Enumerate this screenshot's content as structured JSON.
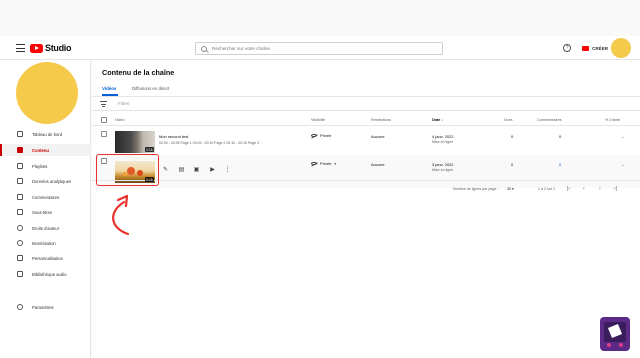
{
  "topbar": {
    "logo_text": "Studio",
    "search_placeholder": "Rechercher sur votre chaîne",
    "create_label": "CRÉER"
  },
  "sidebar": {
    "items": [
      {
        "label": "Tableau de bord",
        "icon": "dashboard-icon"
      },
      {
        "label": "Contenu",
        "icon": "content-icon",
        "active": true
      },
      {
        "label": "Playlists",
        "icon": "playlist-icon"
      },
      {
        "label": "Données analytiques",
        "icon": "analytics-icon"
      },
      {
        "label": "Commentaires",
        "icon": "comments-icon"
      },
      {
        "label": "Sous-titres",
        "icon": "subtitles-icon"
      },
      {
        "label": "Droits d'auteur",
        "icon": "copyright-icon"
      },
      {
        "label": "Monétisation",
        "icon": "monetization-icon"
      },
      {
        "label": "Personnalisation",
        "icon": "customization-icon"
      },
      {
        "label": "Bibliothèque audio",
        "icon": "audio-library-icon"
      }
    ],
    "settings_label": "Paramètres"
  },
  "main": {
    "title": "Contenu de la chaîne",
    "tabs": [
      {
        "label": "Vidéos",
        "active": true
      },
      {
        "label": "Diffusions en direct"
      }
    ],
    "filter_label": "Filtrer",
    "columns": [
      "Vidéo",
      "Visibilité",
      "Restrictions",
      "Date",
      "Vues",
      "Commentaires",
      "% J'aime"
    ],
    "rows": [
      {
        "title": "Mon second test",
        "description": "00:00 - 00:05 Page 1 00:05 - 00:10 Page 2 00:10 - 00:15 Page 3",
        "duration": "0:15",
        "visibility": "Privée",
        "restrictions": "Aucune",
        "date": "4 janv. 2022",
        "date_sub": "Mise en ligne",
        "views": "0",
        "comments": "0",
        "likes": "–"
      },
      {
        "title": "",
        "description": "",
        "duration": "0:15",
        "visibility": "Privée",
        "restrictions": "Aucune",
        "date": "3 janv. 2022",
        "date_sub": "Mise en ligne",
        "views": "0",
        "comments": "0",
        "likes": "–"
      }
    ],
    "pagination": {
      "rows_per_page_label": "Nombre de lignes par page :",
      "rows_per_page": "30",
      "range": "1 à 2 sur 2"
    }
  },
  "colors": {
    "accent": "#cc0000",
    "link": "#065fd4",
    "avatar": "#f5c94a",
    "highlight": "#e8312a"
  }
}
